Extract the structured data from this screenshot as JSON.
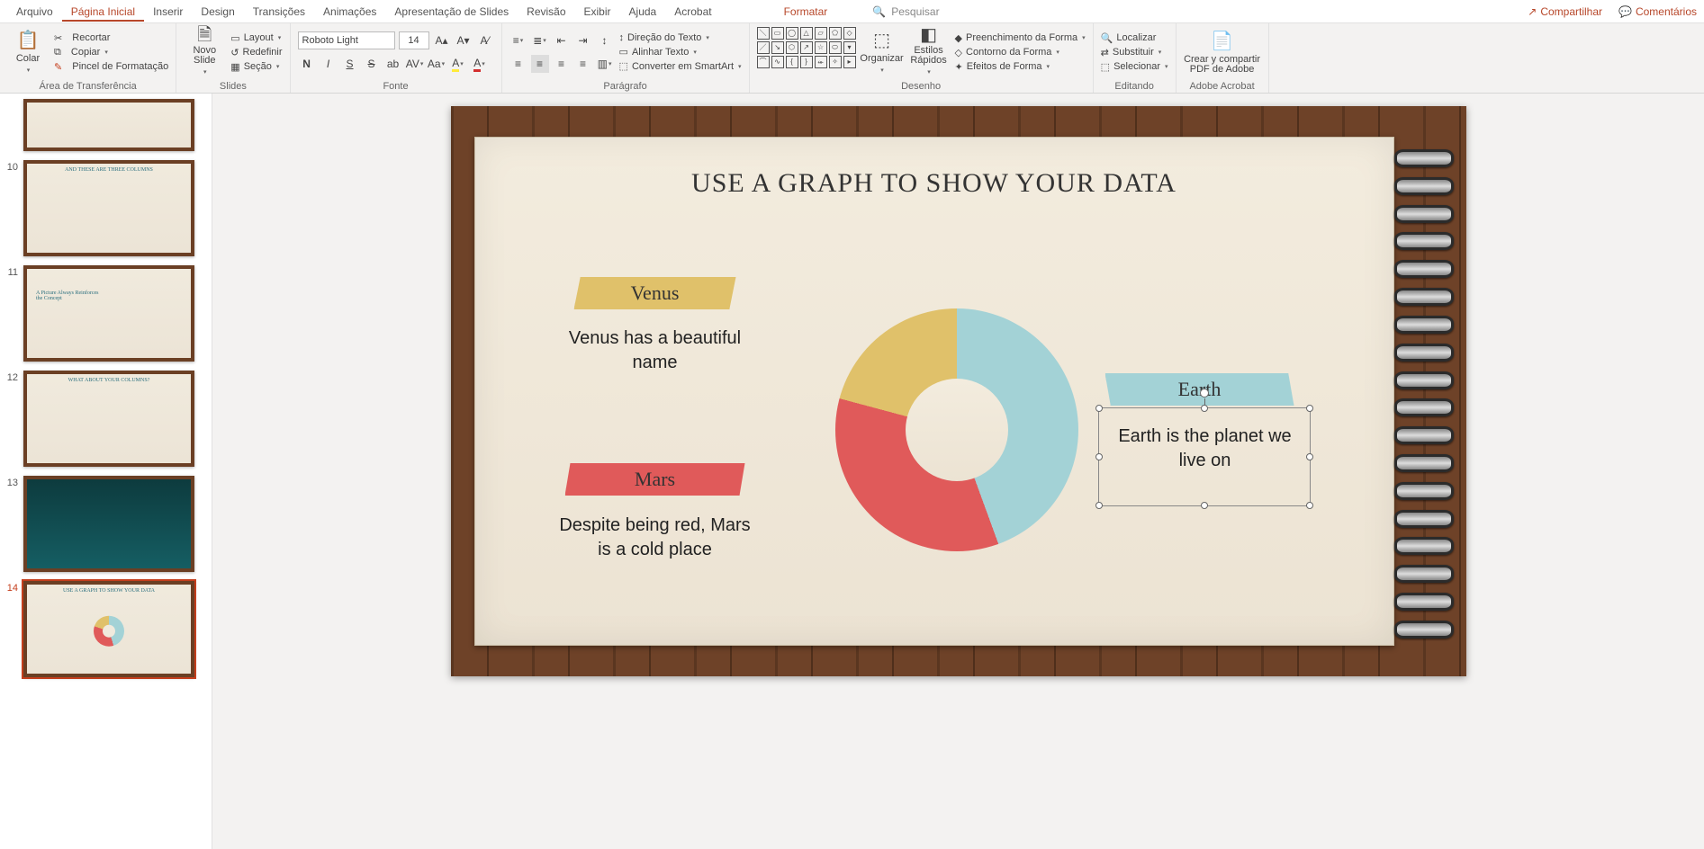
{
  "menu": {
    "items": [
      "Arquivo",
      "Página Inicial",
      "Inserir",
      "Design",
      "Transições",
      "Animações",
      "Apresentação de Slides",
      "Revisão",
      "Exibir",
      "Ajuda",
      "Acrobat"
    ],
    "active": 1,
    "context": "Formatar",
    "search_placeholder": "Pesquisar",
    "share": "Compartilhar",
    "comments": "Comentários"
  },
  "ribbon": {
    "clipboard": {
      "label": "Área de Transferência",
      "paste": "Colar",
      "cut": "Recortar",
      "copy": "Copiar",
      "painter": "Pincel de Formatação"
    },
    "slides": {
      "label": "Slides",
      "new": "Novo Slide",
      "layout": "Layout",
      "reset": "Redefinir",
      "section": "Seção"
    },
    "font": {
      "label": "Fonte",
      "name": "Roboto Light",
      "size": "14"
    },
    "paragraph": {
      "label": "Parágrafo",
      "textdir": "Direção do Texto",
      "align": "Alinhar Texto",
      "smartart": "Converter em SmartArt"
    },
    "drawing": {
      "label": "Desenho",
      "arrange": "Organizar",
      "styles": "Estilos Rápidos",
      "fill": "Preenchimento da Forma",
      "outline": "Contorno da Forma",
      "effects": "Efeitos de Forma"
    },
    "editing": {
      "label": "Editando",
      "find": "Localizar",
      "replace": "Substituir",
      "select": "Selecionar"
    },
    "acrobat": {
      "label": "Adobe Acrobat",
      "btn": "Crear y compartir PDF de Adobe"
    }
  },
  "thumbs": [
    {
      "n": "",
      "title": ""
    },
    {
      "n": "10",
      "title": "AND THESE ARE THREE COLUMNS"
    },
    {
      "n": "11",
      "title": "A Picture Always Reinforces the Concept"
    },
    {
      "n": "12",
      "title": "WHAT ABOUT YOUR COLUMNS?"
    },
    {
      "n": "13",
      "title": ""
    },
    {
      "n": "14",
      "title": "USE A GRAPH TO SHOW YOUR DATA"
    }
  ],
  "slide": {
    "title": "USE A GRAPH TO SHOW YOUR DATA",
    "venus": {
      "label": "Venus",
      "desc": "Venus has a beautiful name"
    },
    "mars": {
      "label": "Mars",
      "desc": "Despite being red, Mars is a cold place"
    },
    "earth": {
      "label": "Earth",
      "desc": "Earth is the planet we live on"
    }
  },
  "chart_data": {
    "type": "pie",
    "title": "USE A GRAPH TO SHOW YOUR DATA",
    "categories": [
      "Earth",
      "Mars",
      "Venus"
    ],
    "values": [
      45,
      35,
      20
    ],
    "colors": [
      "#a3d2d6",
      "#e05a5a",
      "#e0c16a"
    ]
  }
}
